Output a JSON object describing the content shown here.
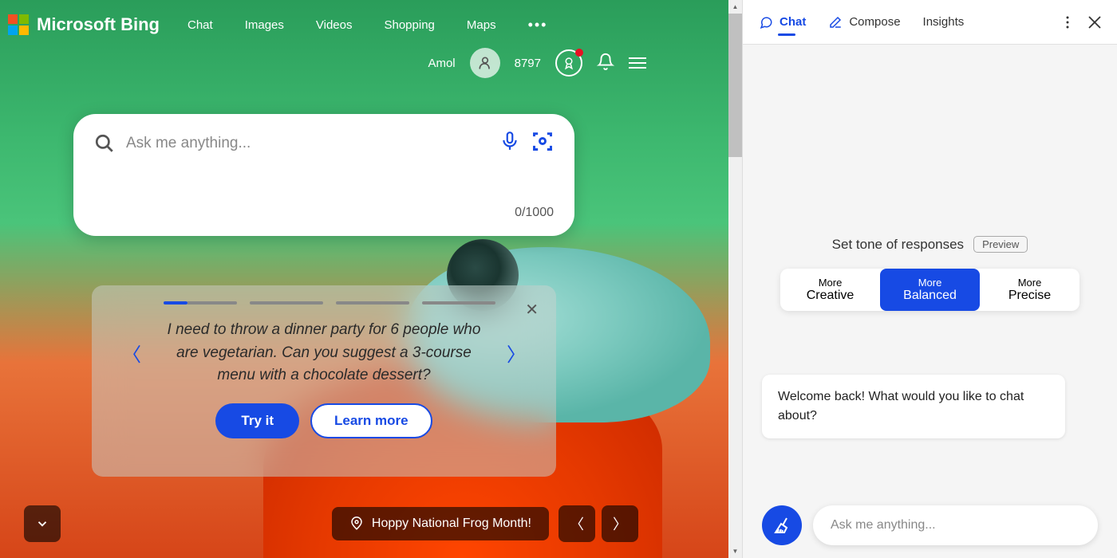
{
  "header": {
    "brand": "Microsoft Bing",
    "nav": [
      "Chat",
      "Images",
      "Videos",
      "Shopping",
      "Maps"
    ],
    "user_name": "Amol",
    "points": "8797"
  },
  "search": {
    "placeholder": "Ask me anything...",
    "char_count": "0/1000"
  },
  "promo": {
    "text": "I need to throw a dinner party for 6 people who are vegetarian. Can you suggest a 3-course menu with a chocolate dessert?",
    "try_label": "Try it",
    "learn_label": "Learn more"
  },
  "bottom": {
    "caption": "Hoppy National Frog Month!"
  },
  "sidebar": {
    "tabs": {
      "chat": "Chat",
      "compose": "Compose",
      "insights": "Insights"
    },
    "tone_title": "Set tone of responses",
    "preview": "Preview",
    "more": "More",
    "tones": [
      "Creative",
      "Balanced",
      "Precise"
    ],
    "welcome": "Welcome back! What would you like to chat about?",
    "input_placeholder": "Ask me anything..."
  }
}
